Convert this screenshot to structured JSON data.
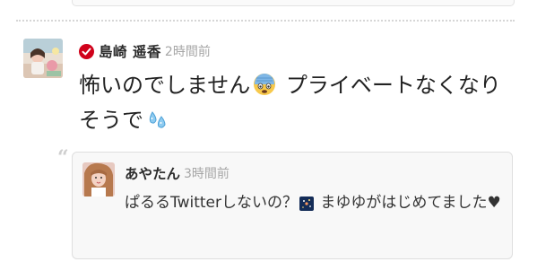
{
  "post": {
    "author": "島崎 遥香",
    "time": "2時間前",
    "text_part1": "怖いのでしません",
    "text_part2": " プライベートなくなりそうで",
    "emoji1": "fearful-face-icon",
    "emoji2": "sweat-droplets-icon",
    "verified_icon": "verified-check-icon"
  },
  "reply": {
    "author": "あやたん",
    "time": "3時間前",
    "text_part1": "ぱるるTwitterしないの？",
    "text_part2": " まゆゆがはじめてました",
    "emoji1": "night-sky-icon",
    "heart": "♥"
  },
  "quote_mark": "“",
  "colors": {
    "verified": "#d0021b",
    "time": "#a6a6a6",
    "card_bg": "#f8f8f8",
    "border": "#dedede"
  }
}
